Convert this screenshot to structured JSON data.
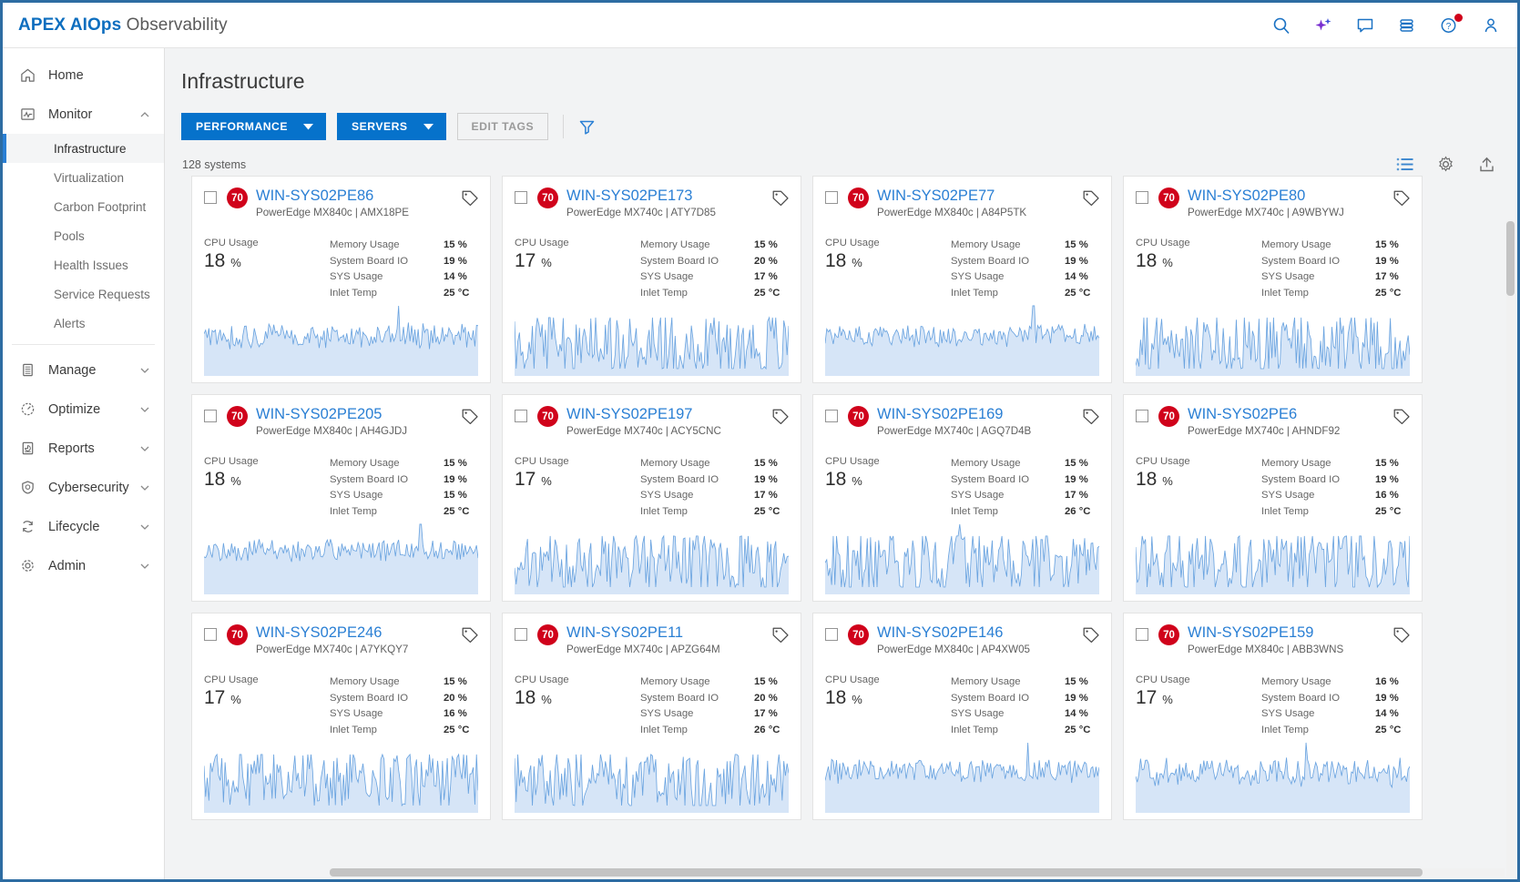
{
  "header": {
    "brand_strong": "APEX AIOps",
    "brand_light": " Observability",
    "icons": [
      {
        "name": "search-icon",
        "label": "Search"
      },
      {
        "name": "ai-sparkle-icon",
        "label": "AI Assistant"
      },
      {
        "name": "feedback-chat-icon",
        "label": "Feedback"
      },
      {
        "name": "stack-layers-icon",
        "label": "Services"
      },
      {
        "name": "help-icon",
        "label": "Help"
      },
      {
        "name": "user-profile-icon",
        "label": "Account"
      }
    ]
  },
  "sidebar": {
    "items": [
      {
        "label": "Home",
        "icon": "home-icon",
        "expandable": false
      },
      {
        "label": "Monitor",
        "icon": "monitor-icon",
        "expandable": true,
        "expanded": true
      },
      {
        "label": "Manage",
        "icon": "manage-icon",
        "expandable": true,
        "expanded": false
      },
      {
        "label": "Optimize",
        "icon": "optimize-icon",
        "expandable": true,
        "expanded": false
      },
      {
        "label": "Reports",
        "icon": "reports-icon",
        "expandable": true,
        "expanded": false
      },
      {
        "label": "Cybersecurity",
        "icon": "cybersecurity-icon",
        "expandable": true,
        "expanded": false
      },
      {
        "label": "Lifecycle",
        "icon": "lifecycle-icon",
        "expandable": true,
        "expanded": false
      },
      {
        "label": "Admin",
        "icon": "admin-gear-icon",
        "expandable": true,
        "expanded": false
      }
    ],
    "monitor_children": [
      {
        "label": "Infrastructure",
        "active": true
      },
      {
        "label": "Virtualization",
        "active": false
      },
      {
        "label": "Carbon Footprint",
        "active": false
      },
      {
        "label": "Pools",
        "active": false
      },
      {
        "label": "Health Issues",
        "active": false
      },
      {
        "label": "Service Requests",
        "active": false
      },
      {
        "label": "Alerts",
        "active": false
      }
    ]
  },
  "main": {
    "page_title": "Infrastructure",
    "toolbar": {
      "performance_label": "PERFORMANCE",
      "servers_label": "SERVERS",
      "edit_tags_label": "EDIT TAGS",
      "filter_icon": "filter-funnel-icon"
    },
    "count_text": "128 systems",
    "view_icons": [
      {
        "name": "list-view-icon"
      },
      {
        "name": "settings-gear-icon"
      },
      {
        "name": "export-upload-icon"
      }
    ],
    "metric_labels": {
      "cpu": "CPU Usage",
      "memory": "Memory Usage",
      "sysboard_io": "System Board IO",
      "sys_usage": "SYS Usage",
      "inlet_temp": "Inlet Temp"
    },
    "colors": {
      "accent": "#0672cb",
      "link": "#2a7fd4",
      "health_red": "#d0021b",
      "spark_line": "#6ba4e0",
      "spark_fill": "#d6e5f7"
    },
    "cards": [
      {
        "health": "70",
        "host": "WIN-SYS02PE86",
        "model": "PowerEdge MX840c | AMX18PE",
        "cpu": "18 %",
        "memory": "15 %",
        "sysboard_io": "19 %",
        "sys_usage": "14 %",
        "inlet_temp": "25 °C",
        "spark": {
          "seed": 11,
          "amp": 0.2,
          "base": 0.62,
          "spike_at": 0.71,
          "fill_from": 0.0
        }
      },
      {
        "health": "70",
        "host": "WIN-SYS02PE173",
        "model": "PowerEdge MX740c | ATY7D85",
        "cpu": "17 %",
        "memory": "15 %",
        "sysboard_io": "20 %",
        "sys_usage": "17 %",
        "inlet_temp": "25 °C",
        "spark": {
          "seed": 23,
          "amp": 0.62,
          "base": 0.45,
          "spike_at": -1,
          "fill_from": 0.0
        }
      },
      {
        "health": "70",
        "host": "WIN-SYS02PE77",
        "model": "PowerEdge MX840c | A84P5TK",
        "cpu": "18 %",
        "memory": "15 %",
        "sysboard_io": "19 %",
        "sys_usage": "14 %",
        "inlet_temp": "25 °C",
        "spark": {
          "seed": 37,
          "amp": 0.18,
          "base": 0.63,
          "spike_at": 0.76,
          "fill_from": 0.0
        }
      },
      {
        "health": "70",
        "host": "WIN-SYS02PE80",
        "model": "PowerEdge MX740c | A9WBYWJ",
        "cpu": "18 %",
        "memory": "15 %",
        "sysboard_io": "19 %",
        "sys_usage": "17 %",
        "inlet_temp": "25 °C",
        "spark": {
          "seed": 41,
          "amp": 0.6,
          "base": 0.45,
          "spike_at": -1,
          "fill_from": 0.0
        }
      },
      {
        "health": "70",
        "host": "WIN-SYS02PE205",
        "model": "PowerEdge MX840c | AH4GJDJ",
        "cpu": "18 %",
        "memory": "15 %",
        "sysboard_io": "19 %",
        "sys_usage": "15 %",
        "inlet_temp": "25 °C",
        "spark": {
          "seed": 53,
          "amp": 0.17,
          "base": 0.7,
          "spike_at": 0.79,
          "fill_from": 0.0
        }
      },
      {
        "health": "70",
        "host": "WIN-SYS02PE197",
        "model": "PowerEdge MX740c | ACY5CNC",
        "cpu": "17 %",
        "memory": "15 %",
        "sysboard_io": "19 %",
        "sys_usage": "17 %",
        "inlet_temp": "25 °C",
        "spark": {
          "seed": 67,
          "amp": 0.6,
          "base": 0.46,
          "spike_at": -1,
          "fill_from": 0.0
        }
      },
      {
        "health": "70",
        "host": "WIN-SYS02PE169",
        "model": "PowerEdge MX740c | AGQ7D4B",
        "cpu": "18 %",
        "memory": "15 %",
        "sysboard_io": "19 %",
        "sys_usage": "17 %",
        "inlet_temp": "26 °C",
        "spark": {
          "seed": 71,
          "amp": 0.58,
          "base": 0.46,
          "spike_at": 0.49,
          "fill_from": 0.0
        }
      },
      {
        "health": "70",
        "host": "WIN-SYS02PE6",
        "model": "PowerEdge MX740c | AHNDF92",
        "cpu": "18 %",
        "memory": "15 %",
        "sysboard_io": "19 %",
        "sys_usage": "16 %",
        "inlet_temp": "25 °C",
        "spark": {
          "seed": 83,
          "amp": 0.58,
          "base": 0.47,
          "spike_at": -1,
          "fill_from": 0.0
        }
      },
      {
        "health": "70",
        "host": "WIN-SYS02PE246",
        "model": "PowerEdge MX740c | A7YKQY7",
        "cpu": "17 %",
        "memory": "15 %",
        "sysboard_io": "20 %",
        "sys_usage": "16 %",
        "inlet_temp": "25 °C",
        "spark": {
          "seed": 97,
          "amp": 0.55,
          "base": 0.48,
          "spike_at": -1,
          "fill_from": 0.0
        }
      },
      {
        "health": "70",
        "host": "WIN-SYS02PE11",
        "model": "PowerEdge MX740c | APZG64M",
        "cpu": "18 %",
        "memory": "15 %",
        "sysboard_io": "20 %",
        "sys_usage": "17 %",
        "inlet_temp": "26 °C",
        "spark": {
          "seed": 103,
          "amp": 0.6,
          "base": 0.45,
          "spike_at": -1,
          "fill_from": 0.0
        }
      },
      {
        "health": "70",
        "host": "WIN-SYS02PE146",
        "model": "PowerEdge MX840c | AP4XW05",
        "cpu": "18 %",
        "memory": "15 %",
        "sysboard_io": "19 %",
        "sys_usage": "14 %",
        "inlet_temp": "25 °C",
        "spark": {
          "seed": 113,
          "amp": 0.19,
          "base": 0.66,
          "spike_at": 0.74,
          "fill_from": 0.0
        }
      },
      {
        "health": "70",
        "host": "WIN-SYS02PE159",
        "model": "PowerEdge MX840c | ABB3WNS",
        "cpu": "17 %",
        "memory": "16 %",
        "sysboard_io": "19 %",
        "sys_usage": "14 %",
        "inlet_temp": "25 °C",
        "spark": {
          "seed": 127,
          "amp": 0.22,
          "base": 0.64,
          "spike_at": 0.62,
          "fill_from": 0.0
        }
      }
    ]
  }
}
